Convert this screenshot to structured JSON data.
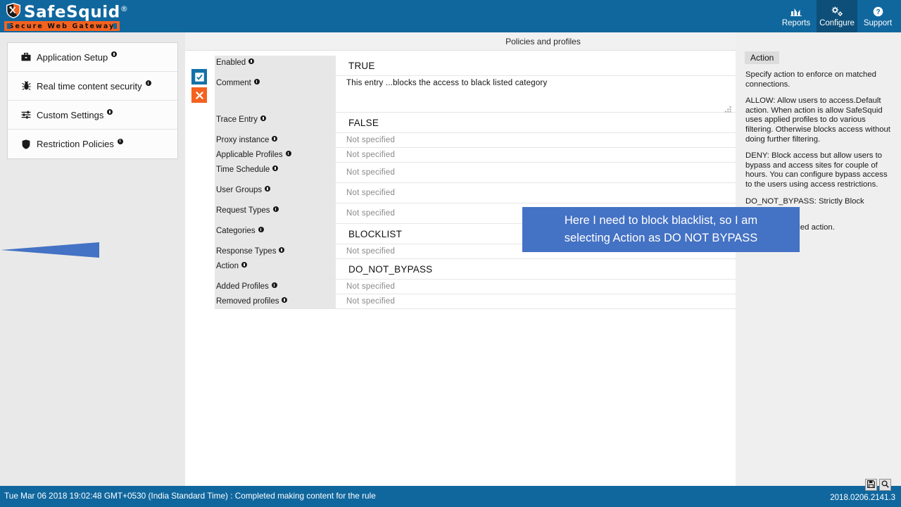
{
  "header": {
    "brand": "SafeSquid",
    "brand_reg": "®",
    "tagline": "Secure Web Gateway",
    "nav": [
      {
        "label": "Reports",
        "icon": "chart-icon",
        "active": false
      },
      {
        "label": "Configure",
        "icon": "gears-icon",
        "active": true
      },
      {
        "label": "Support",
        "icon": "question-circle-icon",
        "active": false
      }
    ]
  },
  "sidebar": {
    "items": [
      {
        "label": "Application Setup",
        "icon": "briefcase-icon"
      },
      {
        "label": "Real time content security",
        "icon": "bug-icon"
      },
      {
        "label": "Custom Settings",
        "icon": "sliders-icon"
      },
      {
        "label": "Restriction Policies",
        "icon": "shield-icon"
      }
    ]
  },
  "content": {
    "title": "Policies and profiles",
    "row_buttons": {
      "enable_label": "☑",
      "delete_label": "✖"
    },
    "fields": [
      {
        "label": "Enabled",
        "value": "TRUE",
        "style": "big",
        "placeholder": false,
        "send": false
      },
      {
        "label": "Comment",
        "value": "This entry ...blocks the access to black listed category",
        "style": "area",
        "placeholder": false,
        "send": false
      },
      {
        "label": "Trace Entry",
        "value": "FALSE",
        "style": "big",
        "placeholder": false,
        "send": false
      },
      {
        "label": "Proxy instance",
        "value": "Not specified",
        "style": "ph",
        "placeholder": true,
        "send": false
      },
      {
        "label": "Applicable Profiles",
        "value": "Not specified",
        "style": "ph",
        "placeholder": true,
        "send": false
      },
      {
        "label": "Time Schedule",
        "value": "Not specified",
        "style": "ph",
        "placeholder": true,
        "send": true
      },
      {
        "label": "User Groups",
        "value": "Not specified",
        "style": "ph",
        "placeholder": true,
        "send": true
      },
      {
        "label": "Request Types",
        "value": "Not specified",
        "style": "ph",
        "placeholder": true,
        "send": true
      },
      {
        "label": "Categories",
        "value": "BLOCKLIST",
        "style": "big",
        "placeholder": false,
        "send": false
      },
      {
        "label": "Response Types",
        "value": "Not specified",
        "style": "ph",
        "placeholder": true,
        "send": false
      },
      {
        "label": "Action",
        "value": "DO_NOT_BYPASS",
        "style": "big",
        "placeholder": false,
        "send": false
      },
      {
        "label": "Added Profiles",
        "value": "Not specified",
        "style": "ph",
        "placeholder": true,
        "send": false
      },
      {
        "label": "Removed profiles",
        "value": "Not specified",
        "style": "ph",
        "placeholder": true,
        "send": false
      }
    ]
  },
  "help": {
    "title": "Action",
    "paragraphs": [
      "Specify action to enforce on matched connections.",
      "ALLOW: Allow users to access.Default action. When action is allow SafeSquid uses applied profiles to do various filtering. Otherwise blocks access without doing further filtering.",
      "DENY: Block access but allow users to bypass and access sites for couple of hours. You can configure bypass access to the users using access restrictions.",
      "DO_NOT_BYPASS: Strictly Block access.",
      "previously applied action."
    ]
  },
  "callout": {
    "line1": "Here I need to block  blacklist, so I am",
    "line2": "selecting Action as DO NOT BYPASS"
  },
  "footer": {
    "status": "Tue Mar 06 2018 19:02:48 GMT+0530 (India Standard Time) : Completed making content for the rule",
    "version": "2018.0206.2141.3",
    "tools": [
      {
        "icon": "save-icon"
      },
      {
        "icon": "search-icon"
      }
    ]
  },
  "colors": {
    "brand_blue": "#10679e",
    "brand_blue_dark": "#0d4f78",
    "accent_orange": "#f4621f",
    "callout_blue": "#4472c4",
    "label_gray": "#e7e7e7"
  }
}
